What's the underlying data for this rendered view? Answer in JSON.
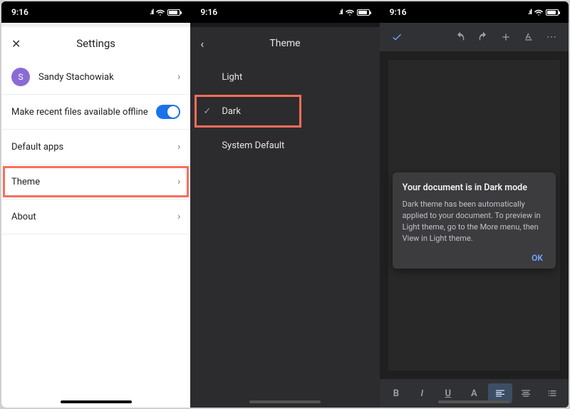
{
  "status": {
    "time": "9:16"
  },
  "settings": {
    "title": "Settings",
    "user_initial": "S",
    "user_name": "Sandy Stachowiak",
    "offline_label": "Make recent files available offline",
    "default_apps": "Default apps",
    "theme": "Theme",
    "about": "About"
  },
  "theme": {
    "title": "Theme",
    "options": {
      "light": "Light",
      "dark": "Dark",
      "system": "System Default"
    }
  },
  "doc": {
    "popup_title": "Your document is in Dark mode",
    "popup_body": "Dark theme has been automatically applied to your document. To preview in Light theme, go to the More menu, then View in Light theme.",
    "popup_ok": "OK",
    "bottom": {
      "bold": "B",
      "italic": "I",
      "underline": "U",
      "textcolor": "A"
    }
  }
}
